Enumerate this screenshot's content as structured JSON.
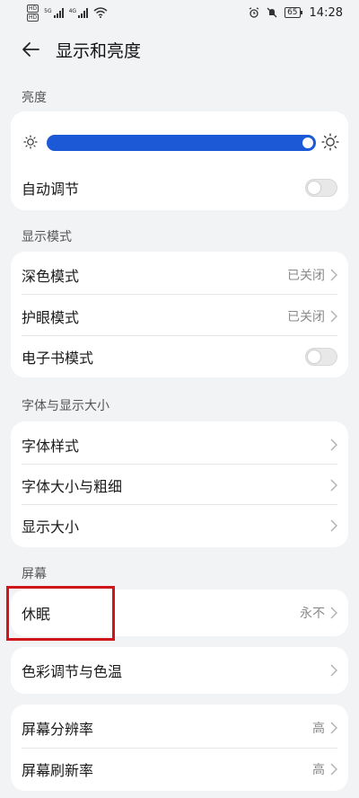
{
  "status_bar": {
    "sim1_badge": "HD",
    "sim1_badge2": "HD",
    "sig1_label": "5G",
    "sig2_label": "4G",
    "battery": "65",
    "time": "14:28"
  },
  "header": {
    "title": "显示和亮度"
  },
  "brightness": {
    "section": "亮度",
    "level_percent": 100,
    "auto_label": "自动调节",
    "auto_on": false
  },
  "display_mode": {
    "section": "显示模式",
    "dark_label": "深色模式",
    "dark_value": "已关闭",
    "eye_label": "护眼模式",
    "eye_value": "已关闭",
    "ebook_label": "电子书模式",
    "ebook_on": false
  },
  "font": {
    "section": "字体与显示大小",
    "style_label": "字体样式",
    "size_label": "字体大小与粗细",
    "display_size_label": "显示大小"
  },
  "screen": {
    "section": "屏幕",
    "sleep_label": "休眠",
    "sleep_value": "永不",
    "color_label": "色彩调节与色温",
    "resolution_label": "屏幕分辨率",
    "resolution_value": "高",
    "refresh_label": "屏幕刷新率",
    "refresh_value": "高"
  },
  "colors": {
    "accent": "#1b59d6",
    "highlight": "#d0161b",
    "background": "#f1f3f5"
  }
}
